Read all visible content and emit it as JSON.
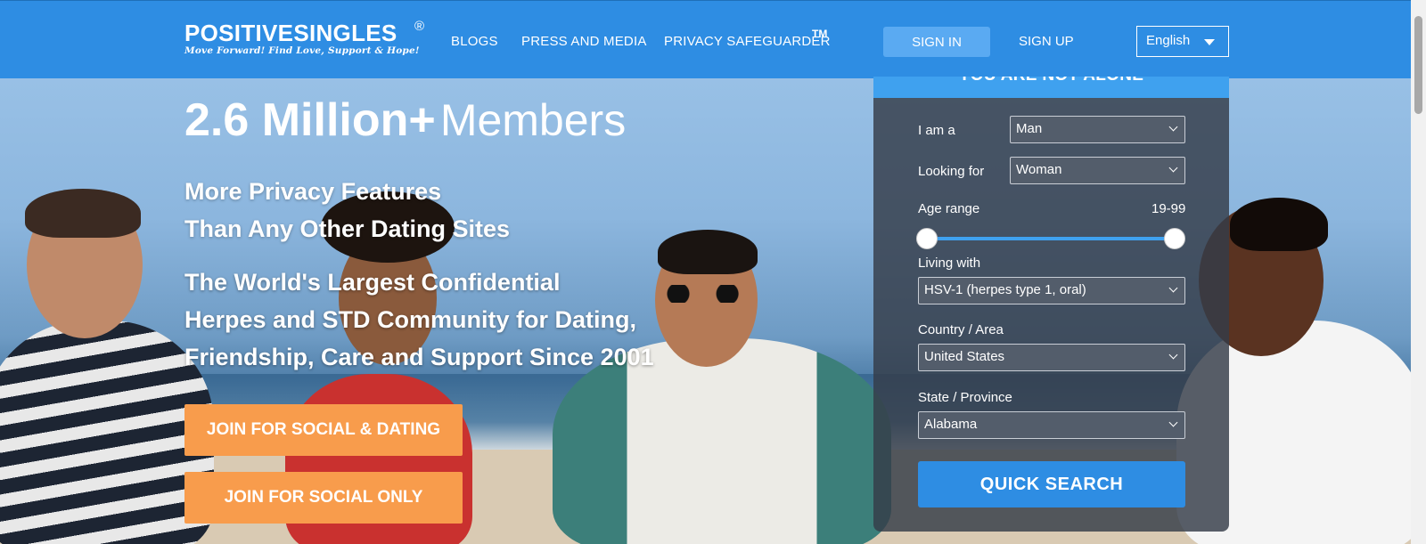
{
  "header": {
    "logo_name": "POSITIVESINGLES",
    "logo_reg": "®",
    "logo_tagline": "Move Forward! Find Love, Support & Hope!",
    "nav": {
      "blogs": "BLOGS",
      "press": "PRESS AND MEDIA",
      "privacy": "PRIVACY SAFEGUARDER",
      "privacy_tm": "TM"
    },
    "sign_in": "SIGN IN",
    "sign_up": "SIGN UP",
    "language": "English"
  },
  "hero": {
    "headline_number": "2.6 Million+",
    "headline_word": "Members",
    "subtitle1_line1": "More Privacy Features",
    "subtitle1_line2": "Than Any Other Dating Sites",
    "subtitle2_line1": "The World's Largest Confidential",
    "subtitle2_line2": "Herpes and STD Community for Dating,",
    "subtitle2_line3": "Friendship, Care and Support Since 2001",
    "join_social_dating": "JOIN FOR SOCIAL & DATING",
    "join_social_only": "JOIN FOR SOCIAL ONLY"
  },
  "search_panel": {
    "banner": "YOU ARE NOT ALONE",
    "i_am_label": "I am a",
    "i_am_value": "Man",
    "looking_for_label": "Looking for",
    "looking_for_value": "Woman",
    "age_range_label": "Age range",
    "age_range_value": "19-99",
    "age_min": 19,
    "age_max": 99,
    "living_with_label": "Living with",
    "living_with_value": "HSV-1 (herpes type 1, oral)",
    "country_label": "Country / Area",
    "country_value": "United States",
    "state_label": "State / Province",
    "state_value": "Alabama",
    "quick_search": "QUICK SEARCH"
  },
  "colors": {
    "header_blue": "#2e8de3",
    "join_orange": "#f89c4c",
    "panel_bg": "#343c48"
  }
}
